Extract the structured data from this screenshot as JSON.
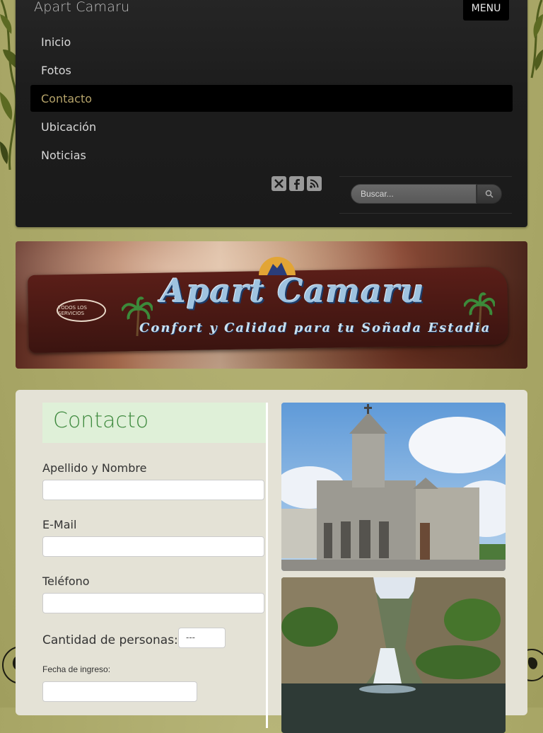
{
  "header": {
    "site_title": "Apart Camaru",
    "menu_button": "MENU"
  },
  "nav": {
    "items": [
      {
        "label": "Inicio",
        "active": false
      },
      {
        "label": "Fotos",
        "active": false
      },
      {
        "label": "Contacto",
        "active": true
      },
      {
        "label": "Ubicación",
        "active": false
      },
      {
        "label": "Noticias",
        "active": false
      }
    ]
  },
  "social": {
    "icons": [
      "twitter-x-icon",
      "facebook-icon",
      "rss-icon"
    ]
  },
  "search": {
    "placeholder": "Buscar..."
  },
  "banner": {
    "sign_title": "Apart Camaru",
    "sign_subtitle": "Confort y Calidad para tu Soñada Estadia",
    "badge_text": "TODOS LOS SERVICIOS"
  },
  "content": {
    "page_title": "Contacto",
    "fields": {
      "name_label": "Apellido y Nombre",
      "email_label": "E-Mail",
      "phone_label": "Teléfono",
      "people_label": "Cantidad de personas:",
      "people_value": "---",
      "checkin_label": "Fecha de ingreso:"
    }
  },
  "colors": {
    "background": "#aaa868",
    "header_bg": "#1d1d1d",
    "active_nav_text": "#b5a36a",
    "title_green": "#3f8a3f",
    "title_box": "#dff0d8",
    "content_bg": "#e4e2d6"
  }
}
